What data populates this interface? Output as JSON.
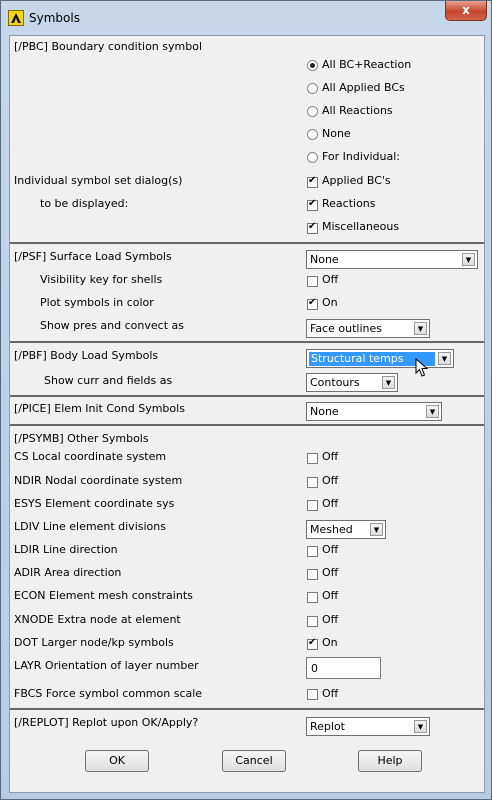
{
  "window": {
    "title": "Symbols",
    "close_label": "x"
  },
  "pbc": {
    "header": "[/PBC] Boundary condition symbol",
    "options": [
      "All BC+Reaction",
      "All Applied BCs",
      "All Reactions",
      "None",
      "For Individual:"
    ],
    "selected": "All BC+Reaction",
    "individual_label_1": "Individual symbol set dialog(s)",
    "individual_label_2": "to be displayed:",
    "individual_options": [
      {
        "label": "Applied BC's",
        "checked": true
      },
      {
        "label": "Reactions",
        "checked": true
      },
      {
        "label": "Miscellaneous",
        "checked": true
      }
    ]
  },
  "psf": {
    "header": "[/PSF]  Surface Load Symbols",
    "value": "None",
    "visibility_label": "Visibility key for shells",
    "visibility_state": "Off",
    "color_label": "Plot symbols in color",
    "color_state": "On",
    "show_label": "Show pres and convect as",
    "show_value": "Face outlines"
  },
  "pbf": {
    "header": "[/PBF]  Body Load Symbols",
    "value": "Structural temps",
    "show_label": "Show curr and fields as",
    "show_value": "Contours"
  },
  "pice": {
    "header": "[/PICE] Elem Init Cond Symbols",
    "value": "None"
  },
  "psymb": {
    "header": "[/PSYMB] Other Symbols",
    "rows": [
      {
        "label": "CS   Local coordinate system",
        "state": "Off"
      },
      {
        "label": "NDIR Nodal coordinate system",
        "state": "Off"
      },
      {
        "label": "ESYS Element coordinate sys",
        "state": "Off"
      },
      {
        "label": "LDIV  Line element divisions",
        "value": "Meshed"
      },
      {
        "label": "LDIR Line direction",
        "state": "Off"
      },
      {
        "label": "ADIR Area direction",
        "state": "Off"
      },
      {
        "label": "ECON Element mesh constraints",
        "state": "Off"
      },
      {
        "label": "XNODE Extra node at element",
        "state": "Off"
      },
      {
        "label": "DOT  Larger node/kp symbols",
        "state": "On"
      },
      {
        "label": "LAYR Orientation of layer number",
        "value": "0"
      },
      {
        "label": "FBCS Force symbol common scale",
        "state": "Off"
      }
    ]
  },
  "replot": {
    "header": "[/REPLOT] Replot upon OK/Apply?",
    "value": "Replot"
  },
  "buttons": {
    "ok": "OK",
    "cancel": "Cancel",
    "help": "Help"
  }
}
